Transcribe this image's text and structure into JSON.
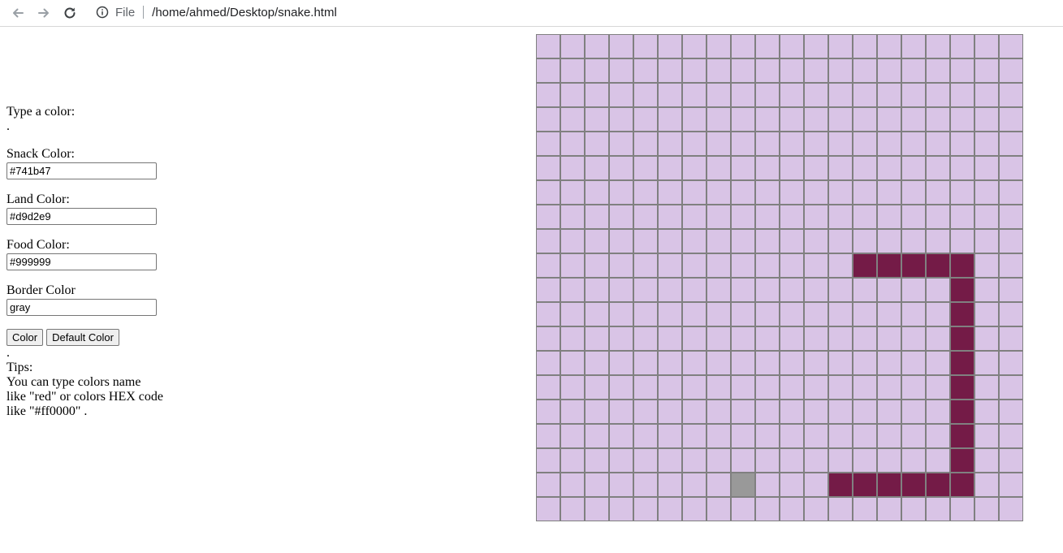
{
  "browser": {
    "scheme_label": "File",
    "url": "/home/ahmed/Desktop/snake.html"
  },
  "panel": {
    "prompt": "Type a color:",
    "dot1": ".",
    "snack_label": "Snack Color:",
    "snack_value": "#741b47",
    "land_label": "Land Color:",
    "land_value": "#d9d2e9",
    "food_label": "Food Color:",
    "food_value": "#999999",
    "border_label": "Border Color",
    "border_value": "gray",
    "color_button": "Color",
    "default_button": "Default Color",
    "dot2": ".",
    "tips_label": "Tips:",
    "tips_text_1": "You can type colors name",
    "tips_text_2": "like \"red\" or colors HEX code",
    "tips_text_3": "like \"#ff0000\" ."
  },
  "board": {
    "rows": 20,
    "cols": 20,
    "colors": {
      "land": "#d9c4e6",
      "snake": "#741b47",
      "food": "#999999",
      "border": "#808080"
    },
    "snake_cells": [
      [
        9,
        13
      ],
      [
        9,
        14
      ],
      [
        9,
        15
      ],
      [
        9,
        16
      ],
      [
        9,
        17
      ],
      [
        10,
        17
      ],
      [
        11,
        17
      ],
      [
        12,
        17
      ],
      [
        13,
        17
      ],
      [
        14,
        17
      ],
      [
        15,
        17
      ],
      [
        16,
        17
      ],
      [
        17,
        17
      ],
      [
        18,
        17
      ],
      [
        18,
        16
      ],
      [
        18,
        15
      ],
      [
        18,
        14
      ],
      [
        18,
        13
      ],
      [
        18,
        12
      ]
    ],
    "food_cells": [
      [
        18,
        8
      ]
    ]
  }
}
